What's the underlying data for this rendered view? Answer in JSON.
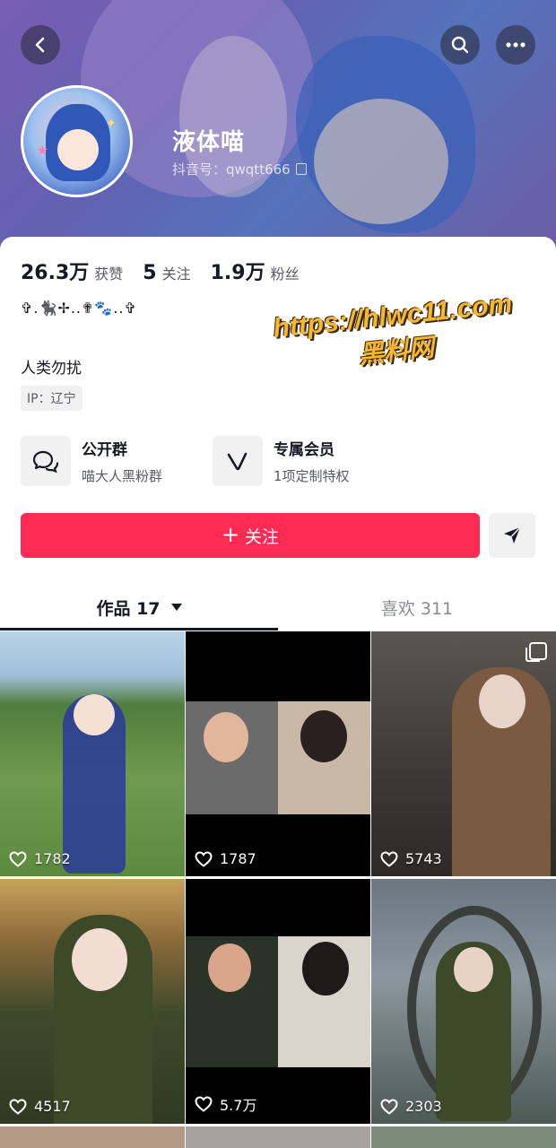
{
  "profile": {
    "nickname": "液体喵",
    "user_id": "抖音号：qwqtt666",
    "tagline": "✞.🐈‍⬛✢..✟🐾..✞",
    "bio": "人类勿扰",
    "ip": "IP：辽宁"
  },
  "stats": {
    "likes_num": "26.3万",
    "likes_label": "获赞",
    "following_num": "5",
    "following_label": "关注",
    "followers_num": "1.9万",
    "followers_label": "粉丝"
  },
  "watermark": {
    "line1": "https://hlwc11.com",
    "line2": "黑料网"
  },
  "features": {
    "group_title": "公开群",
    "group_sub": "喵大人黑粉群",
    "member_title": "专属会员",
    "member_sub": "1项定制特权"
  },
  "actions": {
    "follow_label": "关注",
    "follow_plus": "+"
  },
  "tabs": {
    "works_label": "作品 17",
    "likes_label": "喜欢 311"
  },
  "videos": [
    {
      "likes": "1782"
    },
    {
      "likes": "1787"
    },
    {
      "likes": "5743"
    },
    {
      "likes": "4517"
    },
    {
      "likes": "5.7万"
    },
    {
      "likes": "2303"
    }
  ],
  "colors": {
    "accent": "#fe2c55",
    "text": "#161823",
    "secondary": "#5a5b66"
  },
  "icons": {
    "back": "chevron-left-icon",
    "search": "search-icon",
    "more": "more-dots-icon",
    "copy": "copy-icon",
    "group": "chat-bubbles-icon",
    "member": "v-badge-icon",
    "share": "send-icon",
    "heart": "heart-icon",
    "multi": "multi-image-icon"
  }
}
